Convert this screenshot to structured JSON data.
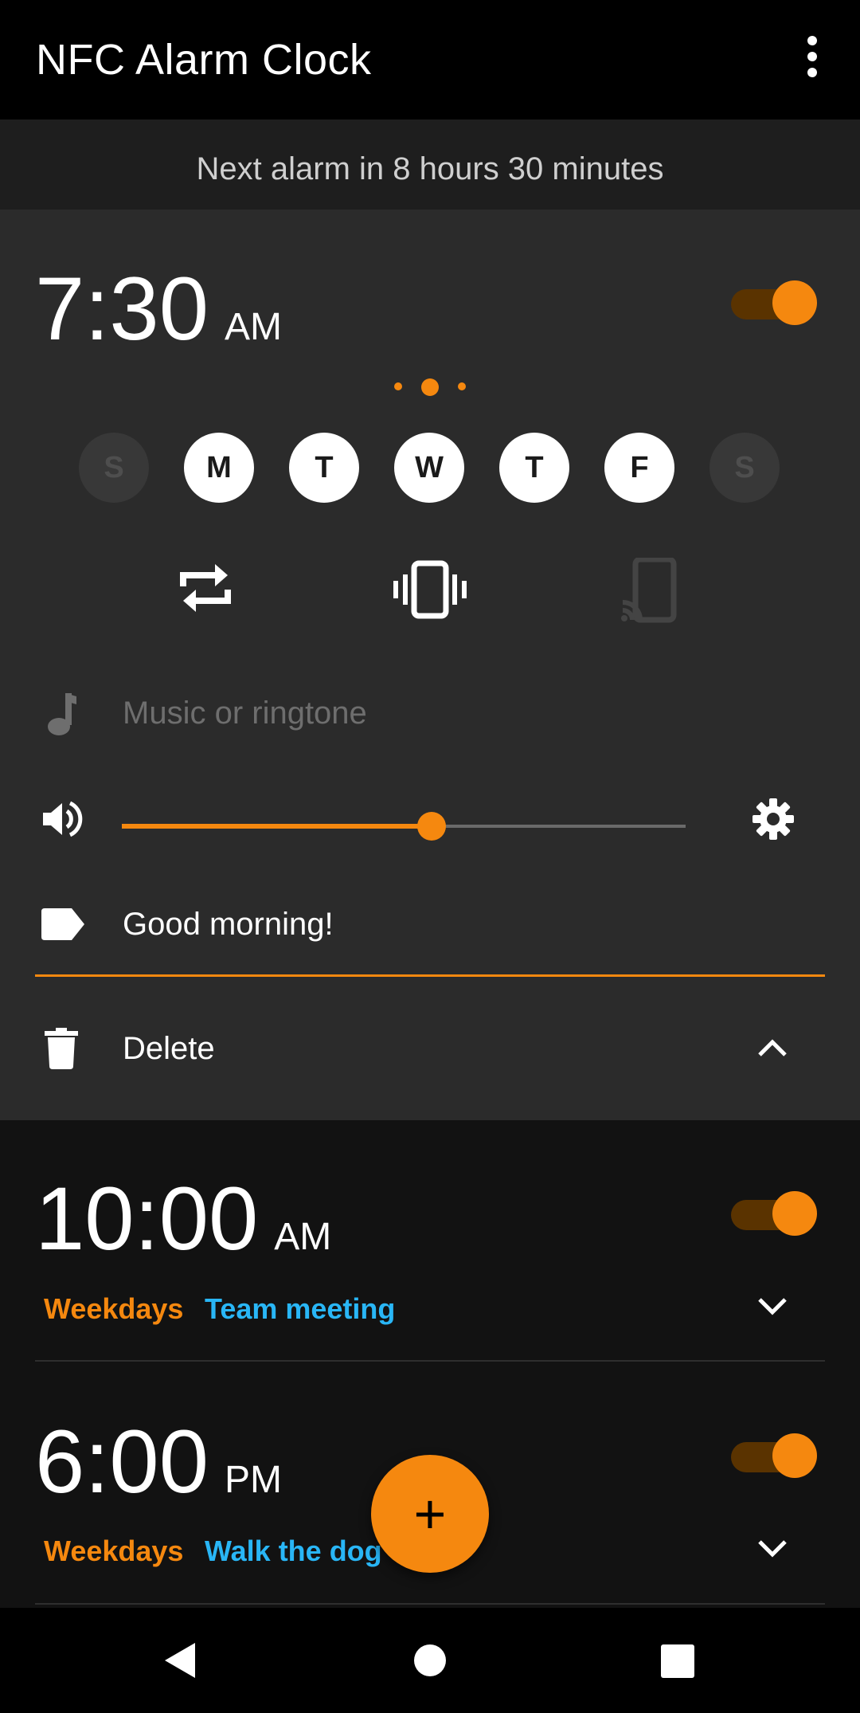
{
  "app": {
    "title": "NFC Alarm Clock",
    "menu_icon": "more-vert-icon"
  },
  "next_alarm": "Next alarm in 8 hours 30 minutes",
  "colors": {
    "accent": "#f5880f",
    "label_blue": "#29b6f6",
    "background": "#121212",
    "card": "#2b2b2b"
  },
  "expanded_alarm": {
    "time": "7:30",
    "ampm": "AM",
    "enabled": true,
    "days": [
      {
        "letter": "S",
        "active": false
      },
      {
        "letter": "M",
        "active": true
      },
      {
        "letter": "T",
        "active": true
      },
      {
        "letter": "W",
        "active": true
      },
      {
        "letter": "T",
        "active": true
      },
      {
        "letter": "F",
        "active": true
      },
      {
        "letter": "S",
        "active": false
      }
    ],
    "option_icons": [
      "repeat-icon",
      "vibrate-icon",
      "nfc-phone-icon"
    ],
    "ringtone_placeholder": "Music or ringtone",
    "volume_fraction": 0.55,
    "label": "Good morning!",
    "delete_label": "Delete"
  },
  "alarms": [
    {
      "time": "10:00",
      "ampm": "AM",
      "enabled": true,
      "repeat": "Weekdays",
      "label": "Team meeting"
    },
    {
      "time": "6:00",
      "ampm": "PM",
      "enabled": true,
      "repeat": "Weekdays",
      "label": "Walk the dog"
    }
  ],
  "fab": {
    "label": "+"
  },
  "nav": [
    "back-icon",
    "home-icon",
    "recents-icon"
  ]
}
